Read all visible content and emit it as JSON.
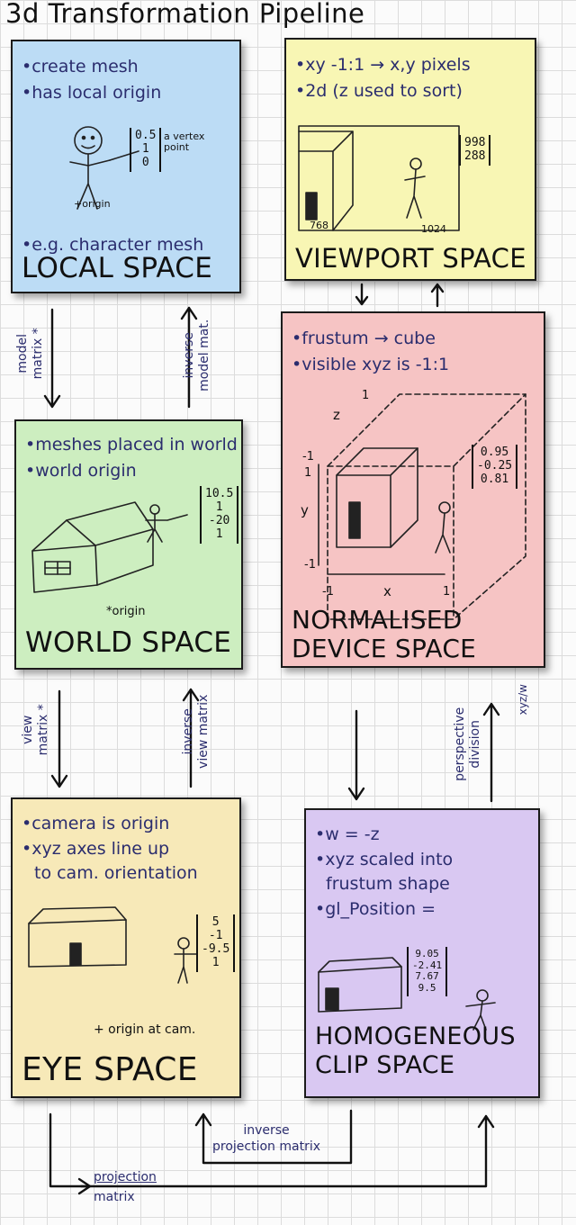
{
  "title": "3d Transformation Pipeline",
  "panels": {
    "local": {
      "name": "LOCAL SPACE",
      "notes": [
        "•create mesh",
        "•has local origin",
        "•e.g. character mesh"
      ],
      "vector": [
        "0.5",
        "1",
        "0"
      ],
      "vector_label": "a vertex point",
      "origin_label": "origin",
      "color": "#bcdcf5"
    },
    "world": {
      "name": "WORLD SPACE",
      "notes": [
        "•meshes placed in world",
        "•world origin"
      ],
      "vector": [
        "10.5",
        "1",
        "-20",
        "1"
      ],
      "origin_label": "origin",
      "color": "#cdeec0"
    },
    "eye": {
      "name": "EYE SPACE",
      "notes": [
        "•camera is origin",
        "•xyz axes line up",
        "to cam. orientation"
      ],
      "vector": [
        "5",
        "-1",
        "-9.5",
        "1"
      ],
      "origin_label": "+ origin at cam.",
      "color": "#f7e9b8"
    },
    "viewport": {
      "name": "VIEWPORT SPACE",
      "notes": [
        "•xy -1:1 → x,y pixels",
        "•2d (z used to sort)"
      ],
      "vector": [
        "998",
        "288"
      ],
      "axis_x": "1024",
      "axis_y": "768",
      "color": "#f8f6b4"
    },
    "ndc": {
      "name_line1": "NORMALISED",
      "name_line2": "DEVICE SPACE",
      "notes": [
        "•frustum → cube",
        "•visible xyz is -1:1"
      ],
      "vector": [
        "0.95",
        "-0.25",
        "0.81"
      ],
      "axis_labels": {
        "z": "z",
        "y": "y",
        "x": "x",
        "one_top": "1",
        "neg_one_a": "-1",
        "one_mid": "1",
        "neg_one_b": "-1",
        "neg_one_c": "-1",
        "one_right": "1"
      },
      "color": "#f6c4c4"
    },
    "clip": {
      "name_line1": "HOMOGENEOUS",
      "name_line2": "CLIP SPACE",
      "notes": [
        "•w = -z",
        "•xyz scaled into",
        "frustum shape",
        "•gl_Position ="
      ],
      "vector": [
        "9.05",
        "-2.41",
        "7.67",
        "9.5"
      ],
      "color": "#d9c8f2"
    }
  },
  "arrows": {
    "model_matrix": [
      "model",
      "matrix *"
    ],
    "inverse_model": [
      "inverse",
      "model mat."
    ],
    "view_matrix": [
      "view",
      "matrix *"
    ],
    "inverse_view": [
      "inverse",
      "view matrix"
    ],
    "perspective_division": [
      "perspective",
      "division"
    ],
    "xyz_over_w": "xyz/w",
    "inverse_projection": [
      "inverse",
      "projection matrix"
    ],
    "projection_matrix": [
      "projection",
      "matrix"
    ]
  }
}
